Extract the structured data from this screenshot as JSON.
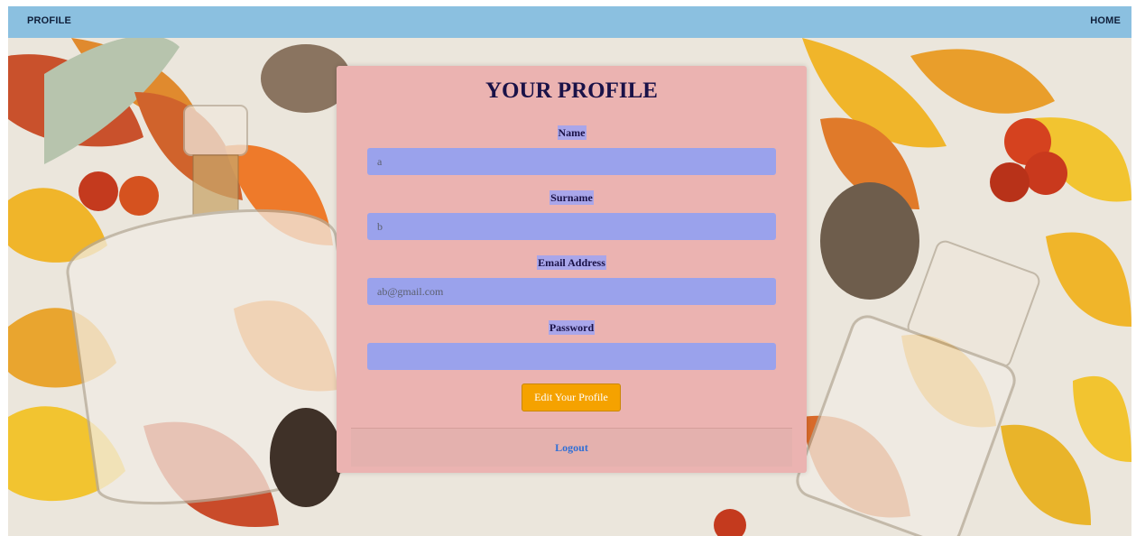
{
  "navbar": {
    "brand": "PROFILE",
    "home_link": "HOME"
  },
  "card": {
    "title": "YOUR PROFILE",
    "fields": [
      {
        "label": "Name",
        "value": "a"
      },
      {
        "label": "Surname",
        "value": "b"
      },
      {
        "label": "Email Address",
        "value": "ab@gmail.com"
      },
      {
        "label": "Password",
        "value": ""
      }
    ],
    "edit_button": "Edit Your Profile",
    "logout_link": "Logout"
  },
  "colors": {
    "navbar_bg": "#8bc0e0",
    "card_bg": "#ebb3b1",
    "input_bg": "#9aa2ec",
    "button_bg": "#f5a200",
    "title_color": "#1a1248",
    "link_color": "#2f6fd6"
  },
  "background": {
    "icons": [
      "autumn-leaf-icon",
      "pinecone-icon",
      "perfume-bottle-icon",
      "berry-icon"
    ]
  }
}
